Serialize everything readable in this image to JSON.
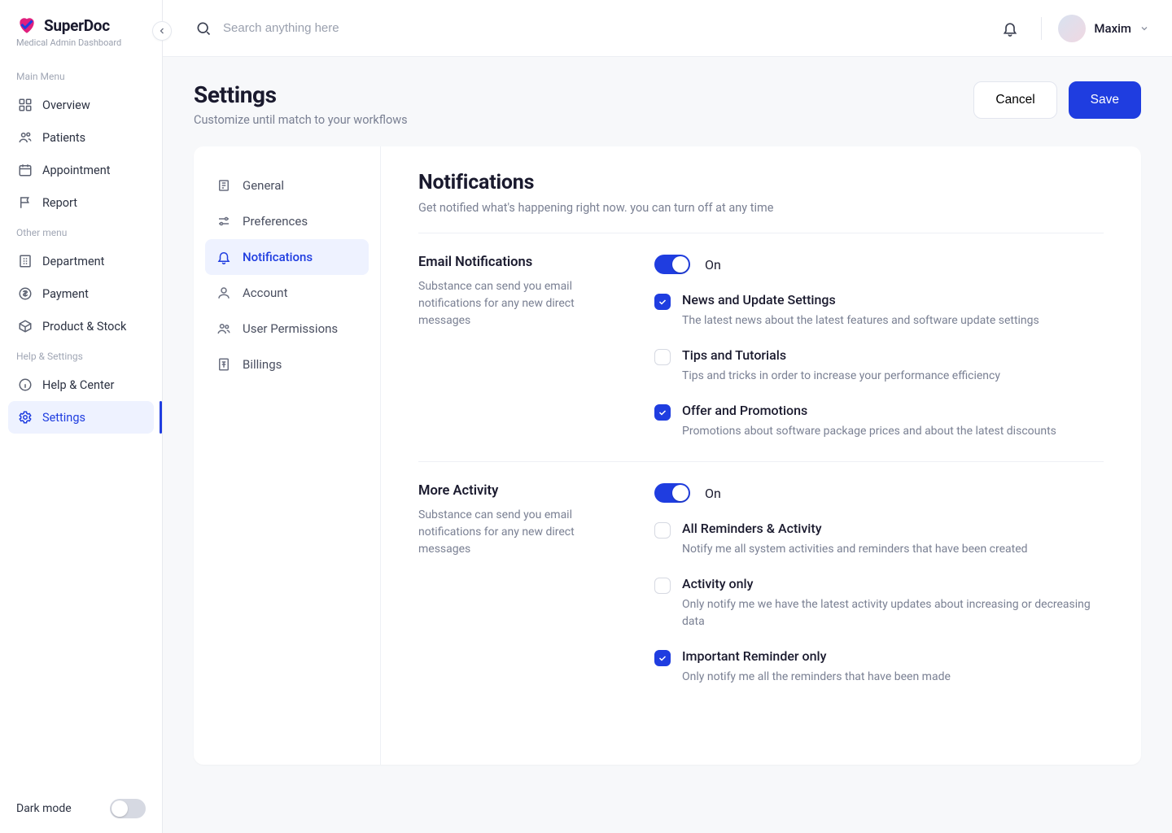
{
  "brand": {
    "name": "SuperDoc",
    "sub": "Medical Admin Dashboard"
  },
  "search": {
    "placeholder": "Search anything here"
  },
  "user": {
    "name": "Maxim"
  },
  "sidebar": {
    "section_main": "Main Menu",
    "section_other": "Other menu",
    "section_help": "Help & Settings",
    "items": {
      "overview": "Overview",
      "patients": "Patients",
      "appointment": "Appointment",
      "report": "Report",
      "department": "Department",
      "payment": "Payment",
      "product_stock": "Product & Stock",
      "help_center": "Help & Center",
      "settings": "Settings"
    },
    "dark_mode": "Dark mode"
  },
  "page": {
    "title": "Settings",
    "sub": "Customize until match to your workflows",
    "cancel": "Cancel",
    "save": "Save"
  },
  "settings_nav": {
    "general": "General",
    "preferences": "Preferences",
    "notifications": "Notifications",
    "account": "Account",
    "user_permissions": "User Permissions",
    "billings": "Billings"
  },
  "notifications": {
    "title": "Notifications",
    "sub": "Get notified what's happening right now. you can turn off at any time",
    "email": {
      "title": "Email Notifications",
      "desc": "Substance can send you email notifications for any new direct messages",
      "toggle_on": true,
      "toggle_label": "On",
      "options": [
        {
          "checked": true,
          "title": "News and Update Settings",
          "desc": "The latest news about the latest features and software update settings"
        },
        {
          "checked": false,
          "title": "Tips and Tutorials",
          "desc": "Tips and tricks in order to increase your performance efficiency"
        },
        {
          "checked": true,
          "title": "Offer and Promotions",
          "desc": "Promotions about software package prices and about the latest discounts"
        }
      ]
    },
    "activity": {
      "title": "More Activity",
      "desc": "Substance can send you email notifications for any new direct messages",
      "toggle_on": true,
      "toggle_label": "On",
      "options": [
        {
          "checked": false,
          "title": "All Reminders & Activity",
          "desc": "Notify me all system activities and reminders that have been created"
        },
        {
          "checked": false,
          "title": "Activity only",
          "desc": "Only notify me we have the latest activity updates about increasing or decreasing data"
        },
        {
          "checked": true,
          "title": "Important Reminder only",
          "desc": "Only notify me all the reminders that have been made"
        }
      ]
    }
  }
}
